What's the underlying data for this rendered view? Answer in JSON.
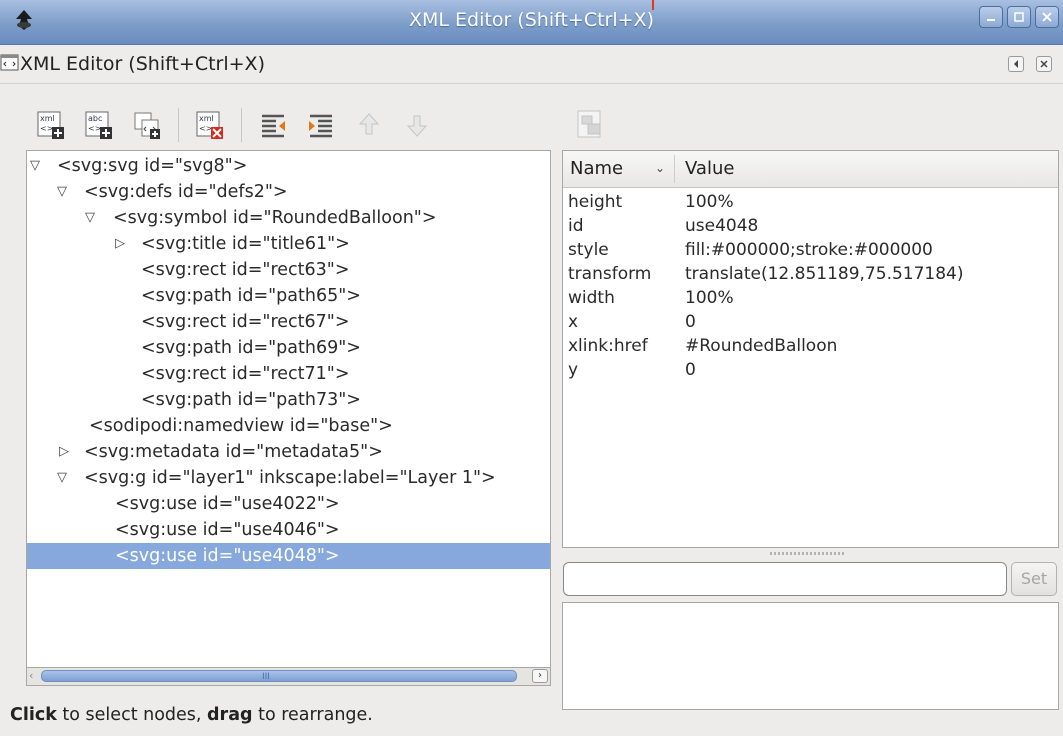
{
  "window": {
    "title": "XML Editor (Shift+Ctrl+X)"
  },
  "dock": {
    "title": "XML Editor (Shift+Ctrl+X)"
  },
  "toolbar": {
    "buttons": [
      {
        "icon": "new-element-node-icon"
      },
      {
        "icon": "new-text-node-icon"
      },
      {
        "icon": "duplicate-node-icon"
      },
      {
        "icon": "delete-node-icon"
      },
      {
        "icon": "unindent-node-icon"
      },
      {
        "icon": "indent-node-icon"
      },
      {
        "icon": "raise-node-icon"
      },
      {
        "icon": "lower-node-icon"
      }
    ]
  },
  "tree": {
    "nodes": [
      {
        "label": "<svg:svg id=\"svg8\">",
        "expander": "▽"
      },
      {
        "label": "<svg:defs id=\"defs2\">",
        "expander": "▽"
      },
      {
        "label": "<svg:symbol id=\"RoundedBalloon\">",
        "expander": "▽"
      },
      {
        "label": "<svg:title id=\"title61\">",
        "expander": "▷"
      },
      {
        "label": "<svg:rect id=\"rect63\">",
        "expander": ""
      },
      {
        "label": "<svg:path id=\"path65\">",
        "expander": ""
      },
      {
        "label": "<svg:rect id=\"rect67\">",
        "expander": ""
      },
      {
        "label": "<svg:path id=\"path69\">",
        "expander": ""
      },
      {
        "label": "<svg:rect id=\"rect71\">",
        "expander": ""
      },
      {
        "label": "<svg:path id=\"path73\">",
        "expander": ""
      },
      {
        "label": "<sodipodi:namedview id=\"base\">",
        "expander": ""
      },
      {
        "label": "<svg:metadata id=\"metadata5\">",
        "expander": "▷"
      },
      {
        "label": "<svg:g id=\"layer1\" inkscape:label=\"Layer 1\">",
        "expander": "▽"
      },
      {
        "label": "<svg:use id=\"use4022\">",
        "expander": ""
      },
      {
        "label": "<svg:use id=\"use4046\">",
        "expander": ""
      },
      {
        "label": "<svg:use id=\"use4048\">",
        "expander": ""
      }
    ],
    "selected_index": 15
  },
  "scrollbar": {
    "grip": "III"
  },
  "attributes": {
    "header_name": "Name",
    "header_sort_arrow": "⌄",
    "header_value": "Value",
    "rows": [
      {
        "name": "height",
        "value": "100%"
      },
      {
        "name": "id",
        "value": "use4048"
      },
      {
        "name": "style",
        "value": "fill:#000000;stroke:#000000"
      },
      {
        "name": "transform",
        "value": "translate(12.851189,75.517184)"
      },
      {
        "name": "width",
        "value": "100%"
      },
      {
        "name": "x",
        "value": "0"
      },
      {
        "name": "xlink:href",
        "value": "#RoundedBalloon"
      },
      {
        "name": "y",
        "value": "0"
      }
    ]
  },
  "value_editor": {
    "input_value": "",
    "set_label": "Set"
  },
  "status": {
    "part1": "Click",
    "part2": " to select nodes, ",
    "part3": "drag",
    "part4": " to rearrange."
  },
  "colors": {
    "selection": "#86a8dc",
    "titlebar": "#7d9dc9"
  }
}
